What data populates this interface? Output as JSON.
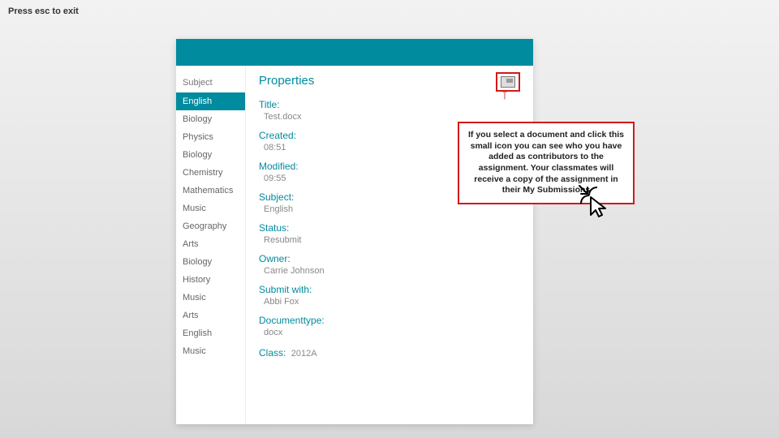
{
  "esc_hint": "Press esc to exit",
  "sidebar": {
    "header": "Subject",
    "items": [
      {
        "label": "English",
        "selected": true
      },
      {
        "label": "Biology"
      },
      {
        "label": "Physics"
      },
      {
        "label": "Biology"
      },
      {
        "label": "Chemistry"
      },
      {
        "label": "Mathematics"
      },
      {
        "label": "Music"
      },
      {
        "label": "Geography"
      },
      {
        "label": "Arts"
      },
      {
        "label": "Biology"
      },
      {
        "label": "History"
      },
      {
        "label": "Music"
      },
      {
        "label": "Arts"
      },
      {
        "label": "English"
      },
      {
        "label": "Music"
      }
    ]
  },
  "panel": {
    "title": "Properties",
    "props": {
      "title_label": "Title:",
      "title_value": "Test.docx",
      "created_label": "Created:",
      "created_value": "08:51",
      "modified_label": "Modified:",
      "modified_value": "09:55",
      "subject_label": "Subject:",
      "subject_value": "English",
      "status_label": "Status:",
      "status_value": "Resubmit",
      "owner_label": "Owner:",
      "owner_value": "Carrie Johnson",
      "submitwith_label": "Submit with:",
      "submitwith_value": "Abbi Fox",
      "doctype_label": "Documenttype:",
      "doctype_value": "docx",
      "class_label": "Class:",
      "class_value": "2012A"
    }
  },
  "callout": {
    "text": "If you select a document and click this small icon you can see who you have added as contributors to the assignment. Your classmates will receive a copy of the assignment in their My Submissions"
  }
}
